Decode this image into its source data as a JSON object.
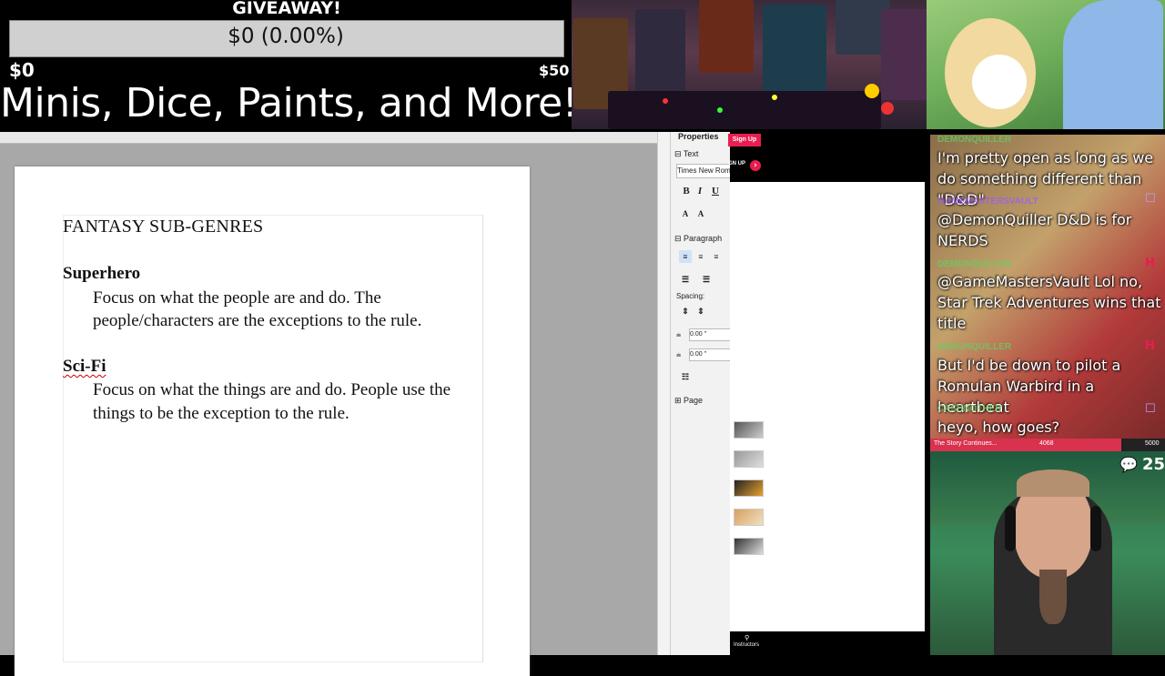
{
  "overlay": {
    "giveaway_title": "GIVEAWAY!",
    "progress_text": "$0 (0.00%)",
    "progress_fraction": 0.0,
    "min_label": "$0",
    "max_label": "$50",
    "headline": "Minis, Dice, Paints, and More!"
  },
  "document": {
    "title": "FANTASY SUB-GENRES",
    "sections": [
      {
        "heading": "Superhero",
        "body": "Focus on what the people are and do. The people/characters are the exceptions to the rule."
      },
      {
        "heading": "Sci-Fi",
        "body": "Focus on what the things are and do. People use the things to be the exception to the rule."
      }
    ]
  },
  "properties": {
    "header": "Properties",
    "text_section": "Text",
    "font_name": "Times New Roman",
    "bold": "B",
    "italic": "I",
    "underline": "U",
    "paragraph_section": "Paragraph",
    "spacing_label": "Spacing:",
    "spacing_above": "0.00 \"",
    "spacing_below": "0.00 \"",
    "page_section": "Page"
  },
  "web": {
    "signup_label": "Sign Up",
    "signup2_label": "GN UP",
    "instructors_label": "Instructors"
  },
  "chat": {
    "messages": [
      {
        "user": "DEMONQUILLER",
        "user_color": "#5fd35f",
        "text": "I'm pretty open as long as we do something different than \"D&D\""
      },
      {
        "user": "GAMEMASTERSVAULT",
        "user_color": "#9b59ff",
        "text": "@DemonQuiller D&D is for NERDS"
      },
      {
        "user": "DEMONQUILLER",
        "user_color": "#5fd35f",
        "text": "@GameMastersVault Lol no, Star Trek Adventures wins that title"
      },
      {
        "user": "DEMONQUILLER",
        "user_color": "#5fd35f",
        "text": "But I'd be down to pilot a Romulan Warbird in a heartbeat"
      },
      {
        "user": "CASHNOTHER",
        "user_color": "#5fd35f",
        "text": "heyo, how goes?"
      }
    ]
  },
  "goal": {
    "label": "The Story Continues...",
    "current": "4068",
    "max": "5000",
    "fraction": 0.8136
  },
  "stream": {
    "viewer_count": "25"
  },
  "colors": {
    "accent": "#e91e4f",
    "twitch_purple": "#9146ff"
  }
}
